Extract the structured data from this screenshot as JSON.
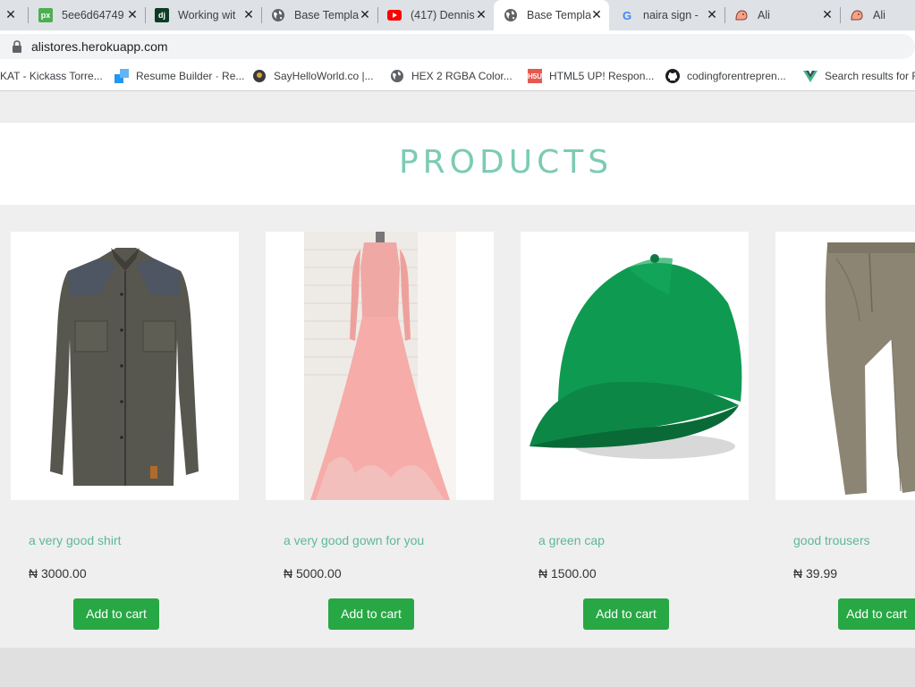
{
  "browser": {
    "tabs": [
      {
        "title": "",
        "favicon": "generic-icon",
        "has_close": true
      },
      {
        "title": "5ee6d64749",
        "favicon": "px-icon",
        "has_close": true
      },
      {
        "title": "Working wit",
        "favicon": "dj-icon",
        "has_close": true
      },
      {
        "title": "Base Templa",
        "favicon": "globe-icon",
        "has_close": true
      },
      {
        "title": "(417) Dennis",
        "favicon": "youtube-icon",
        "has_close": true
      },
      {
        "title": "Base Templa",
        "favicon": "globe-icon",
        "has_close": true,
        "active": true
      },
      {
        "title": "naira sign - ",
        "favicon": "google-icon",
        "has_close": true
      },
      {
        "title": "Ali",
        "favicon": "ali-icon",
        "has_close": true
      },
      {
        "title": "Ali",
        "favicon": "ali-icon",
        "has_close": false
      }
    ],
    "url": "alistores.herokuapp.com",
    "bookmarks": [
      {
        "label": "KAT - Kickass Torre...",
        "favicon": "kat-icon"
      },
      {
        "label": "Resume Builder · Re...",
        "favicon": "resume-icon"
      },
      {
        "label": "SayHelloWorld.co |...",
        "favicon": "sayhello-icon"
      },
      {
        "label": "HEX 2 RGBA Color...",
        "favicon": "globe-icon"
      },
      {
        "label": "HTML5 UP! Respon...",
        "favicon": "html5up-icon"
      },
      {
        "label": "codingforentrepren...",
        "favicon": "github-icon"
      },
      {
        "label": "Search results for F",
        "favicon": "vue-icon"
      }
    ]
  },
  "page": {
    "heading": "PRODUCTS",
    "products": [
      {
        "name": "a very good shirt",
        "price": "₦ 3000.00",
        "button": "Add to cart",
        "image": "shirt-image"
      },
      {
        "name": "a very good gown for you",
        "price": "₦ 5000.00",
        "button": "Add to cart",
        "image": "gown-image"
      },
      {
        "name": "a green cap",
        "price": "₦ 1500.00",
        "button": "Add to cart",
        "image": "cap-image"
      },
      {
        "name": "good trousers",
        "price": "₦ 39.99",
        "button": "Add to cart",
        "image": "trousers-image"
      }
    ]
  },
  "colors": {
    "accent": "#7ccbb4",
    "product_name": "#5cb89a",
    "button": "#28a745"
  }
}
